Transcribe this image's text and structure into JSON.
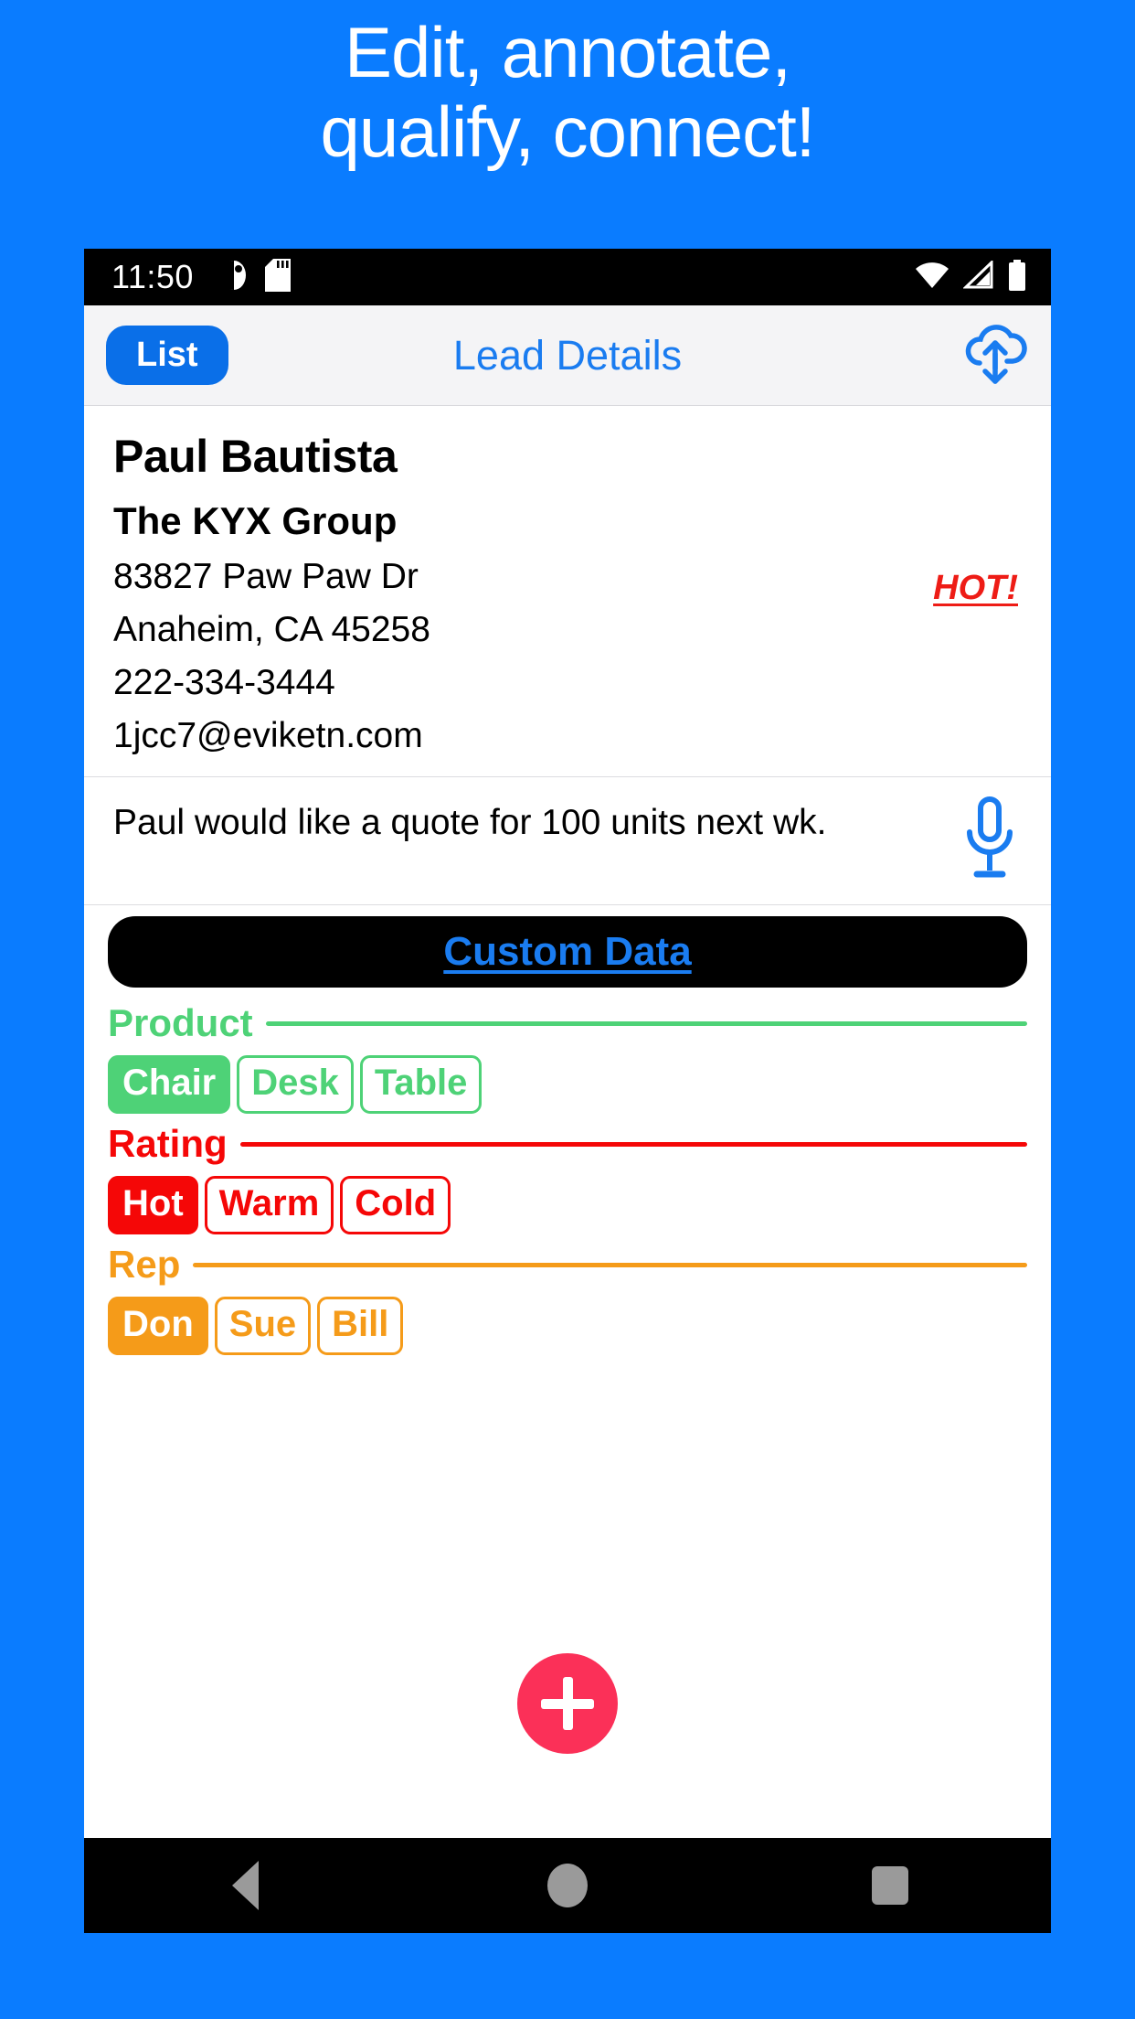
{
  "promo": {
    "line1": "Edit, annotate,",
    "line2": "qualify, connect!"
  },
  "status_bar": {
    "time": "11:50",
    "icons": [
      "do-not-disturb-icon",
      "sd-card-icon"
    ],
    "right_icons": [
      "wifi-icon",
      "cell-signal-icon",
      "battery-icon"
    ]
  },
  "appbar": {
    "back_label": "List",
    "title": "Lead Details",
    "sync_icon": "cloud-sync-icon"
  },
  "lead": {
    "name": "Paul Bautista",
    "company": "The KYX Group",
    "address_line1": "83827 Paw Paw Dr",
    "address_line2": "Anaheim, CA 45258",
    "phone": "222-334-3444",
    "email": "1jcc7@eviketn.com",
    "flag": "HOT!",
    "flag_color": "#ee1c16"
  },
  "note": {
    "text": "Paul would like a quote for 100 units next wk.",
    "mic_icon": "microphone-icon"
  },
  "custom_data": {
    "header_label": "Custom Data",
    "header_bg": "#000000",
    "header_text_color": "#1a7cf0",
    "fields": [
      {
        "title": "Product",
        "color": "#4ed277",
        "options": [
          {
            "label": "Chair",
            "selected": true
          },
          {
            "label": "Desk",
            "selected": false
          },
          {
            "label": "Table",
            "selected": false
          }
        ]
      },
      {
        "title": "Rating",
        "color": "#f50707",
        "options": [
          {
            "label": "Hot",
            "selected": true
          },
          {
            "label": "Warm",
            "selected": false
          },
          {
            "label": "Cold",
            "selected": false
          }
        ]
      },
      {
        "title": "Rep",
        "color": "#f59b19",
        "options": [
          {
            "label": "Don",
            "selected": true
          },
          {
            "label": "Sue",
            "selected": false
          },
          {
            "label": "Bill",
            "selected": false
          }
        ]
      }
    ]
  },
  "fab": {
    "icon": "plus-icon",
    "color": "#fb3058"
  },
  "android_nav": {
    "back": "back-icon",
    "home": "home-icon",
    "recents": "recents-icon"
  },
  "theme": {
    "background": "#0a7cff",
    "accent": "#1a7cf0"
  }
}
